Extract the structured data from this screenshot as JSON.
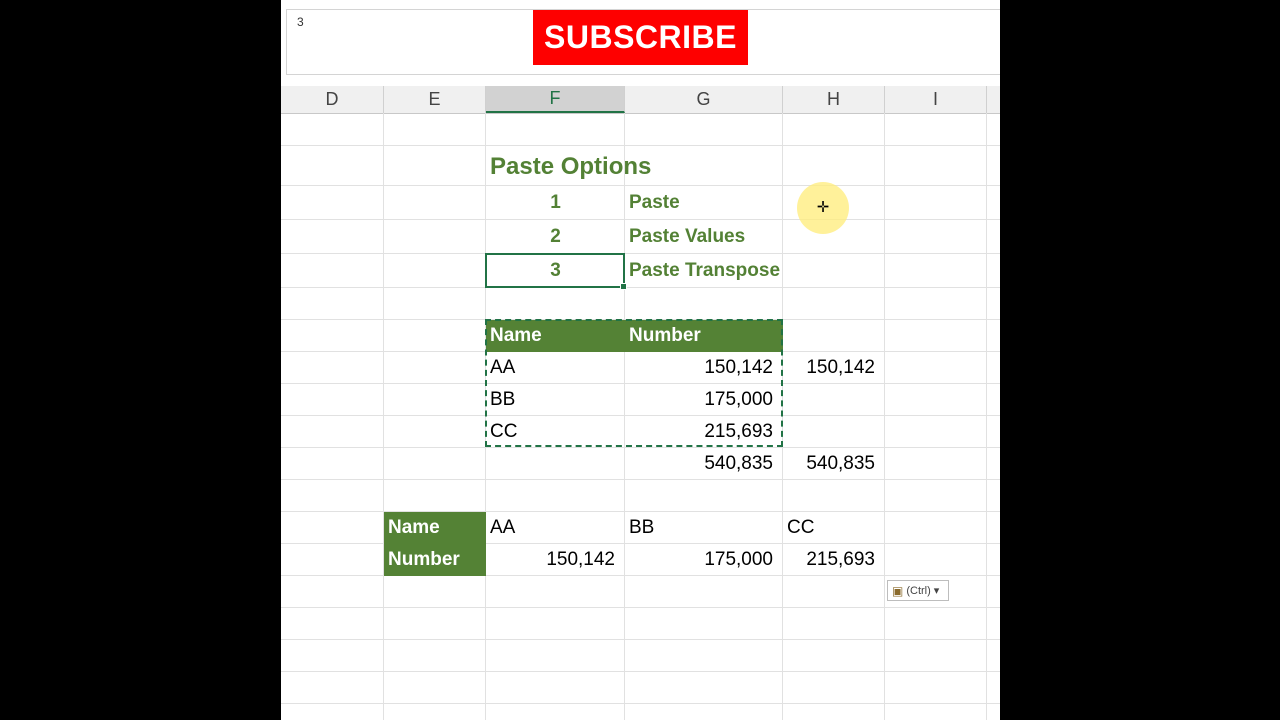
{
  "formula_bar": {
    "content": "3"
  },
  "banner": {
    "label": "SUBSCRIBE",
    "color": "#fe0000"
  },
  "columns": [
    "D",
    "E",
    "F",
    "G",
    "H",
    "I"
  ],
  "selected_column": "F",
  "paste_options": {
    "title": "Paste Options",
    "items": [
      {
        "num": "1",
        "label": "Paste"
      },
      {
        "num": "2",
        "label": "Paste Values"
      },
      {
        "num": "3",
        "label": "Paste Transpose"
      }
    ]
  },
  "table": {
    "headers": [
      "Name",
      "Number"
    ],
    "rows": [
      {
        "name": "AA",
        "number": "150,142",
        "extra": "150,142"
      },
      {
        "name": "BB",
        "number": "175,000",
        "extra": ""
      },
      {
        "name": "CC",
        "number": "215,693",
        "extra": ""
      }
    ],
    "total": "540,835",
    "total_extra": "540,835"
  },
  "transposed": {
    "row_labels": [
      "Name",
      "Number"
    ],
    "names": [
      "AA",
      "BB",
      "CC"
    ],
    "numbers": [
      "150,142",
      "175,000",
      "215,693"
    ]
  },
  "paste_button": {
    "label": "(Ctrl)",
    "caret": "▾"
  },
  "colors": {
    "accent_green": "#548235",
    "text_green": "#538135",
    "selection": "#217346"
  }
}
